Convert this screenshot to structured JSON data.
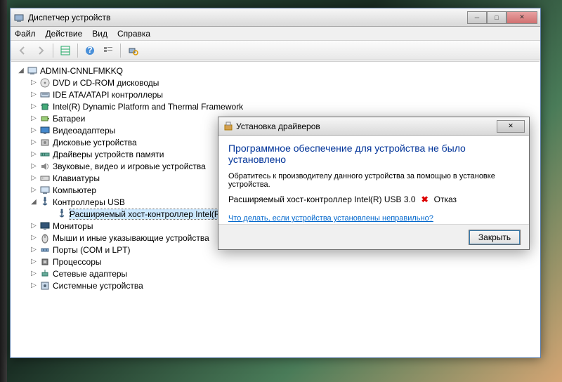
{
  "main_window": {
    "title": "Диспетчер устройств",
    "menu": {
      "file": "Файл",
      "action": "Действие",
      "view": "Вид",
      "help": "Справка"
    }
  },
  "tree": {
    "root": "ADMIN-CNNLFMKKQ",
    "items": [
      {
        "label": "DVD и CD-ROM дисководы",
        "icon": "disc"
      },
      {
        "label": "IDE ATA/ATAPI контроллеры",
        "icon": "ide"
      },
      {
        "label": "Intel(R) Dynamic Platform and Thermal Framework",
        "icon": "chip"
      },
      {
        "label": "Батареи",
        "icon": "battery"
      },
      {
        "label": "Видеоадаптеры",
        "icon": "display"
      },
      {
        "label": "Дисковые устройства",
        "icon": "disk"
      },
      {
        "label": "Драйверы устройств памяти",
        "icon": "mem"
      },
      {
        "label": "Звуковые, видео и игровые устройства",
        "icon": "sound"
      },
      {
        "label": "Клавиатуры",
        "icon": "keyboard"
      },
      {
        "label": "Компьютер",
        "icon": "computer"
      },
      {
        "label": "Контроллеры USB",
        "icon": "usb",
        "expanded": true
      },
      {
        "label": "Мониторы",
        "icon": "monitor"
      },
      {
        "label": "Мыши и иные указывающие устройства",
        "icon": "mouse"
      },
      {
        "label": "Порты (COM и LPT)",
        "icon": "port"
      },
      {
        "label": "Процессоры",
        "icon": "cpu"
      },
      {
        "label": "Сетевые адаптеры",
        "icon": "net"
      },
      {
        "label": "Системные устройства",
        "icon": "sys"
      }
    ],
    "usb_child": "Расширяемый хост-контроллер Intel(R) USB"
  },
  "dialog": {
    "title": "Установка драйверов",
    "heading": "Программное обеспечение для устройства не было установлено",
    "message": "Обратитесь к производителу данного устройства за помощью в установке устройства.",
    "device_name": "Расширяемый хост-контроллер Intel(R) USB 3.0",
    "device_status": "Отказ",
    "link": "Что делать, если устройства установлены неправильно?",
    "close_btn": "Закрыть"
  }
}
